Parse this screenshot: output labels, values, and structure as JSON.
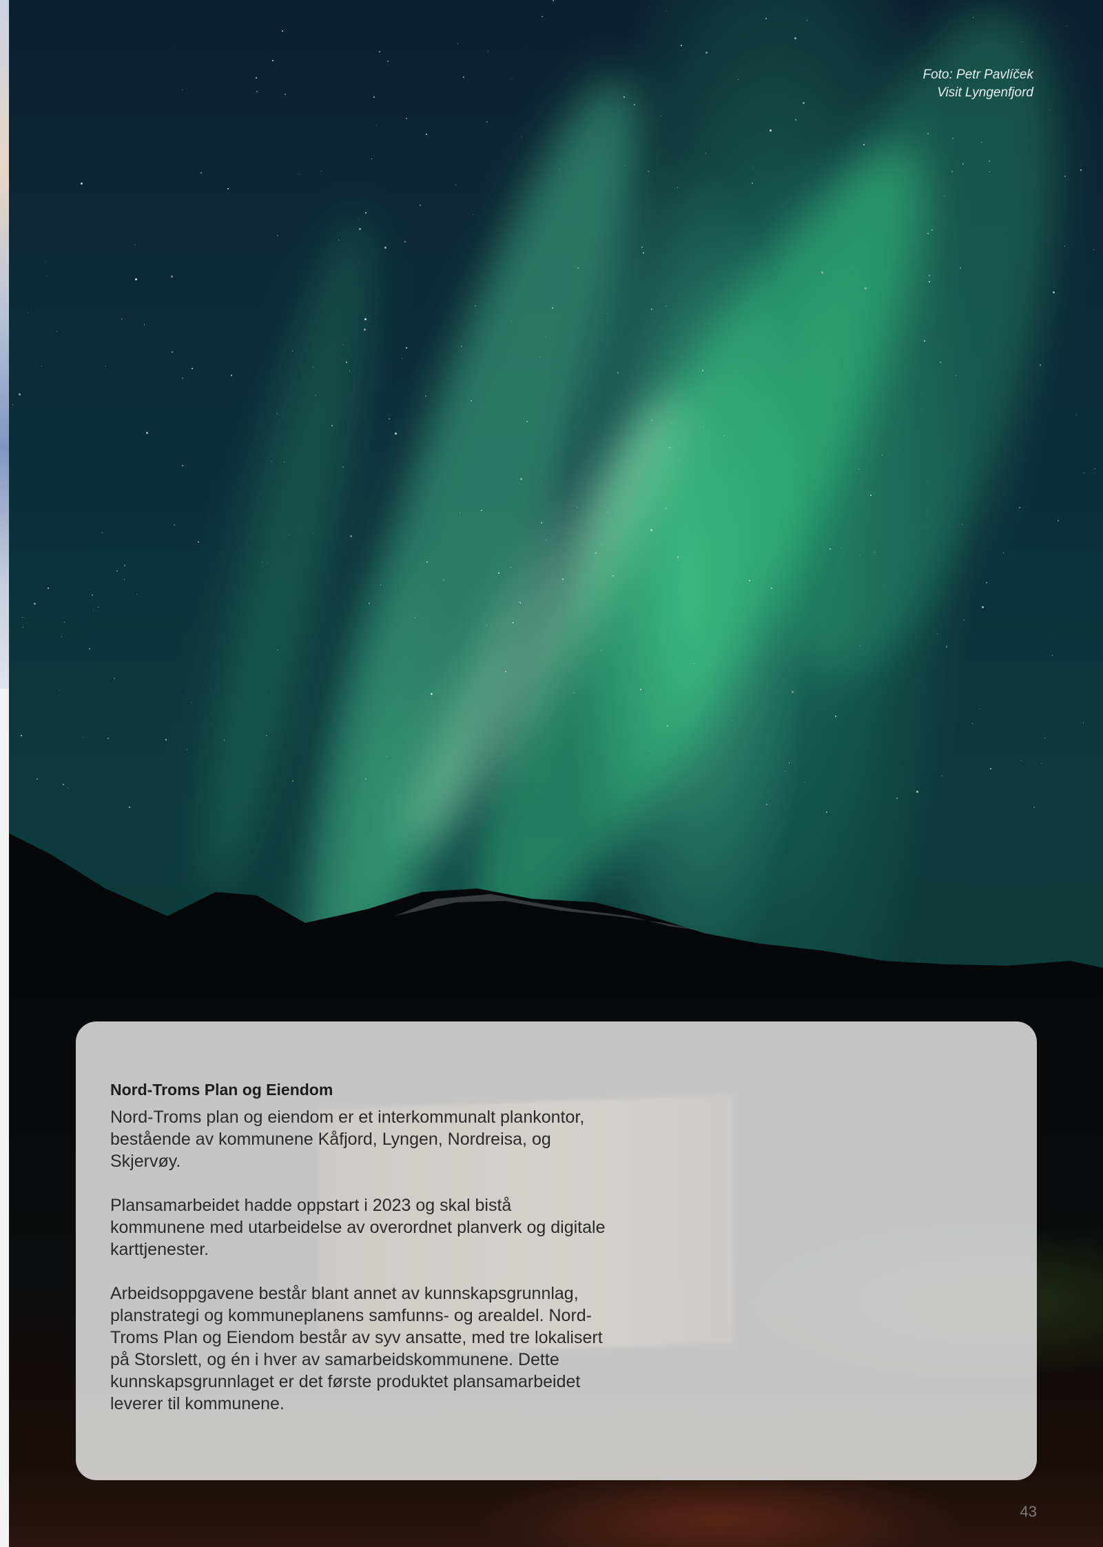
{
  "photo": {
    "credit_line1": "Foto: Petr Pavlíček",
    "credit_line2": "Visit Lyngenfjord"
  },
  "panel": {
    "title": "Nord-Troms Plan og Eiendom",
    "paragraphs": [
      "Nord-Troms plan og eiendom er et interkommunalt plankontor, bestående av kommunene Kåfjord, Lyngen, Nordreisa, og Skjervøy.",
      "Plansamarbeidet hadde oppstart i 2023 og skal bistå kommunene med utarbeidelse av overordnet planverk og digitale karttjenester.",
      "Arbeidsoppgavene består blant annet av kunnskapsgrunnlag, planstrategi og kommuneplanens samfunns- og arealdel. Nord-Troms Plan og Eiendom består av syv ansatte, med tre lokalisert på Storslett, og én i hver av samarbeidskommunene. Dette kunnskapsgrunnlaget er det første produktet plansamarbeidet leverer til kommunene."
    ]
  },
  "page_number": "43"
}
